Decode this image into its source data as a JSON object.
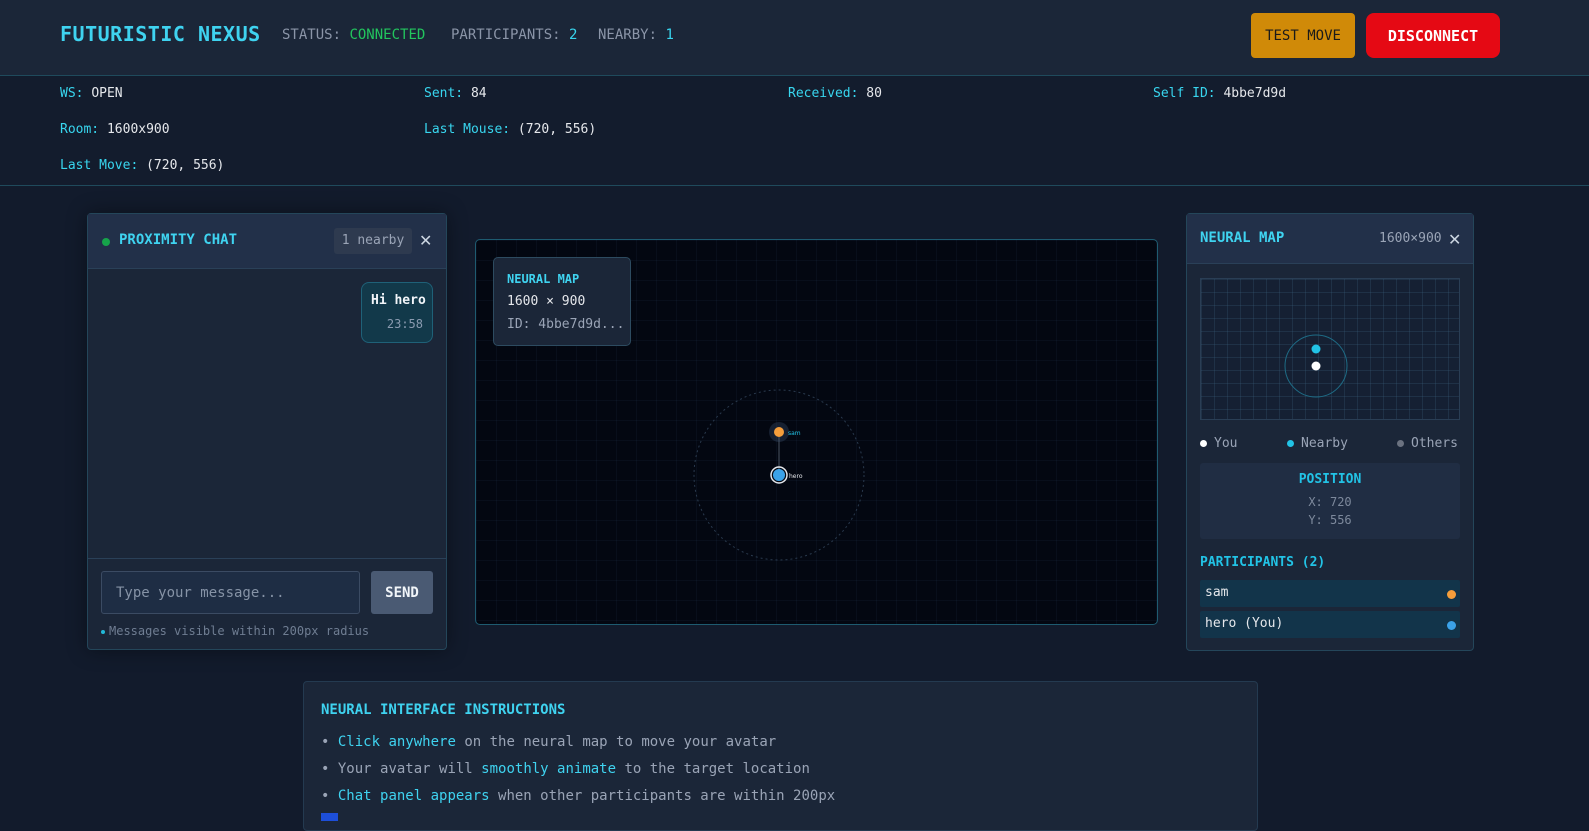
{
  "header": {
    "title": "FUTURISTIC NEXUS",
    "status_label": "STATUS:",
    "status_value": "CONNECTED",
    "participants_label": "PARTICIPANTS:",
    "participants_value": "2",
    "nearby_label": "NEARBY:",
    "nearby_value": "1",
    "test_move_label": "TEST MOVE",
    "disconnect_label": "DISCONNECT",
    "status_color": "#22c55e",
    "disconnect_color": "#e50914",
    "test_move_color": "#d08a08"
  },
  "debug": {
    "ws_label": "WS:",
    "ws_value": "OPEN",
    "sent_label": "Sent:",
    "sent_value": "84",
    "received_label": "Received:",
    "received_value": "80",
    "self_id_label": "Self ID:",
    "self_id_value": "4bbe7d9d",
    "room_label": "Room:",
    "room_value": "1600x900",
    "last_mouse_label": "Last Mouse:",
    "last_mouse_value": "(720, 556)",
    "last_move_label": "Last Move:",
    "last_move_value": "(720, 556)"
  },
  "chat": {
    "title": "PROXIMITY CHAT",
    "nearby_badge": "1 nearby",
    "close_icon": "close-icon",
    "messages": [
      {
        "text": "Hi hero",
        "time": "23:58"
      }
    ],
    "input_placeholder": "Type your message...",
    "send_label": "SEND",
    "hint": "Messages visible within 200px radius"
  },
  "map": {
    "info_title": "NEURAL MAP",
    "info_size": "1600 × 900",
    "info_id": "ID: 4bbe7d9d...",
    "avatars": [
      {
        "name": "sam",
        "color": "#f59e3b"
      },
      {
        "name": "hero",
        "color": "#3ba2e8"
      }
    ]
  },
  "minimap": {
    "title": "NEURAL MAP",
    "size": "1600×900",
    "legend": [
      {
        "label": "You",
        "color": "#ffffff"
      },
      {
        "label": "Nearby",
        "color": "#22c3e6"
      },
      {
        "label": "Others",
        "color": "#6b7280"
      }
    ],
    "position_title": "POSITION",
    "position_x": "X: 720",
    "position_y": "Y: 556",
    "participants_title": "PARTICIPANTS (2)",
    "participants": [
      {
        "name": "sam",
        "color": "#f59e3b"
      },
      {
        "name": "hero (You)",
        "color": "#3ba2e8"
      }
    ]
  },
  "instructions": {
    "title": "NEURAL INTERFACE INSTRUCTIONS",
    "lines": [
      {
        "bullet": "•",
        "pre": "",
        "hl": "Click anywhere",
        "post": " on the neural map to move your avatar"
      },
      {
        "bullet": "•",
        "pre": "Your avatar will ",
        "hl": "smoothly animate",
        "post": " to the target location"
      },
      {
        "bullet": "•",
        "pre": "",
        "hl": "Chat panel appears",
        "post": " when other participants are within 200px"
      }
    ]
  }
}
